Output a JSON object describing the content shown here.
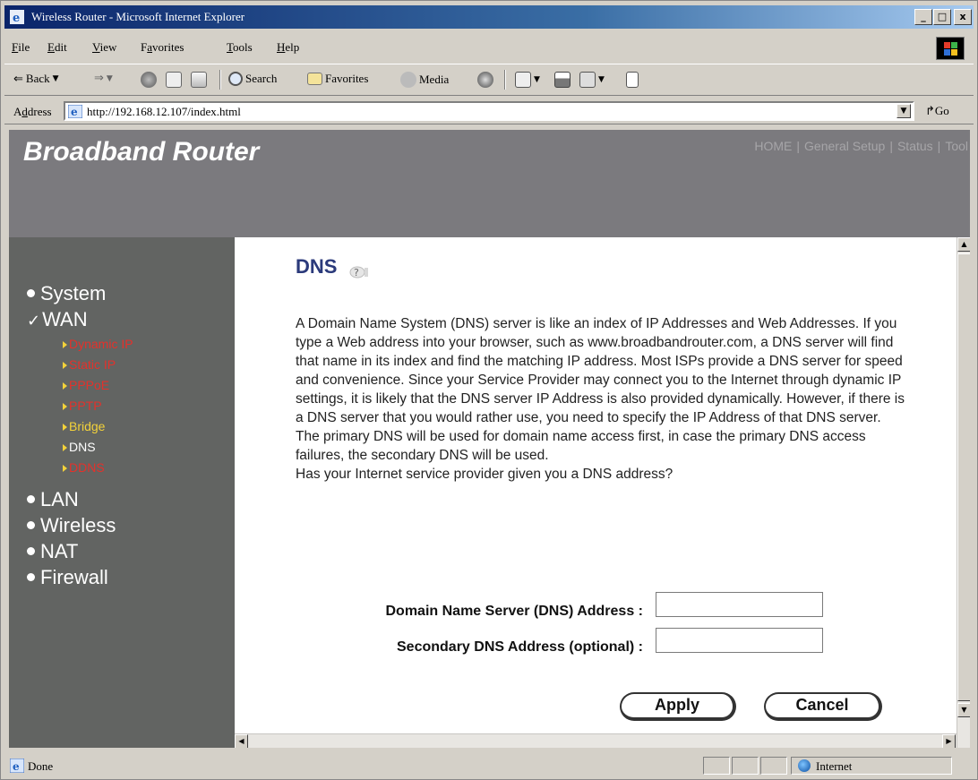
{
  "window": {
    "title": "Wireless Router - Microsoft Internet Explorer",
    "minimize": "_",
    "maximize": "□",
    "close": "x"
  },
  "menu": [
    {
      "first": "F",
      "rest": "ile"
    },
    {
      "first": "E",
      "rest": "dit"
    },
    {
      "first": "V",
      "rest": "iew"
    },
    {
      "pre": "F",
      "first": "a",
      "rest": "vorites"
    },
    {
      "first": "T",
      "rest": "ools"
    },
    {
      "first": "H",
      "rest": "elp"
    }
  ],
  "toolbar": {
    "back": "Back",
    "search": "Search",
    "favorites": "Favorites",
    "media": "Media"
  },
  "address": {
    "label_first": "A",
    "label_u": "d",
    "label_rest": "dress",
    "url": "http://192.168.12.107/index.html",
    "go": "Go"
  },
  "banner": {
    "brand": "Broadband Router",
    "nav": [
      "HOME",
      "General Setup",
      "Status",
      "Tool"
    ]
  },
  "sidebar": {
    "items": [
      {
        "label": "System",
        "marker": "bullet"
      },
      {
        "label": "WAN",
        "marker": "check"
      },
      {
        "label": "LAN",
        "marker": "bullet"
      },
      {
        "label": "Wireless",
        "marker": "bullet"
      },
      {
        "label": "NAT",
        "marker": "bullet"
      },
      {
        "label": "Firewall",
        "marker": "bullet"
      }
    ],
    "wan_subitems": [
      {
        "label": "Dynamic IP",
        "color": "#e4312b"
      },
      {
        "label": "Static IP",
        "color": "#e4312b"
      },
      {
        "label": "PPPoE",
        "color": "#e4312b"
      },
      {
        "label": "PPTP",
        "color": "#e4312b"
      },
      {
        "label": "Bridge",
        "color": "#f3d23a"
      },
      {
        "label": "DNS",
        "color": "#ffffff"
      },
      {
        "label": "DDNS",
        "color": "#e4312b"
      }
    ]
  },
  "main": {
    "heading": "DNS",
    "description": "A Domain Name System (DNS) server is like an index of IP Addresses and Web Addresses. If you type a Web address into your browser, such as www.broadbandrouter.com, a DNS server will find that name in its index and find the matching IP address. Most ISPs provide a DNS server for speed and convenience. Since your Service Provider may connect you to the Internet through dynamic IP settings, it is likely that the DNS server IP Address is also provided dynamically. However, if there is a DNS server that you would rather use, you need to specify the IP Address of that DNS server. The primary DNS will be used for domain name access first, in case the primary DNS access failures, the secondary DNS will be used.",
    "question": "Has your Internet service provider given you a DNS address?",
    "fields": {
      "primary_label": "Domain Name Server (DNS) Address :",
      "primary_value": "",
      "secondary_label": "Secondary DNS Address (optional) :",
      "secondary_value": ""
    },
    "buttons": {
      "apply": "Apply",
      "cancel": "Cancel"
    }
  },
  "status": {
    "text": "Done",
    "zone": "Internet"
  }
}
